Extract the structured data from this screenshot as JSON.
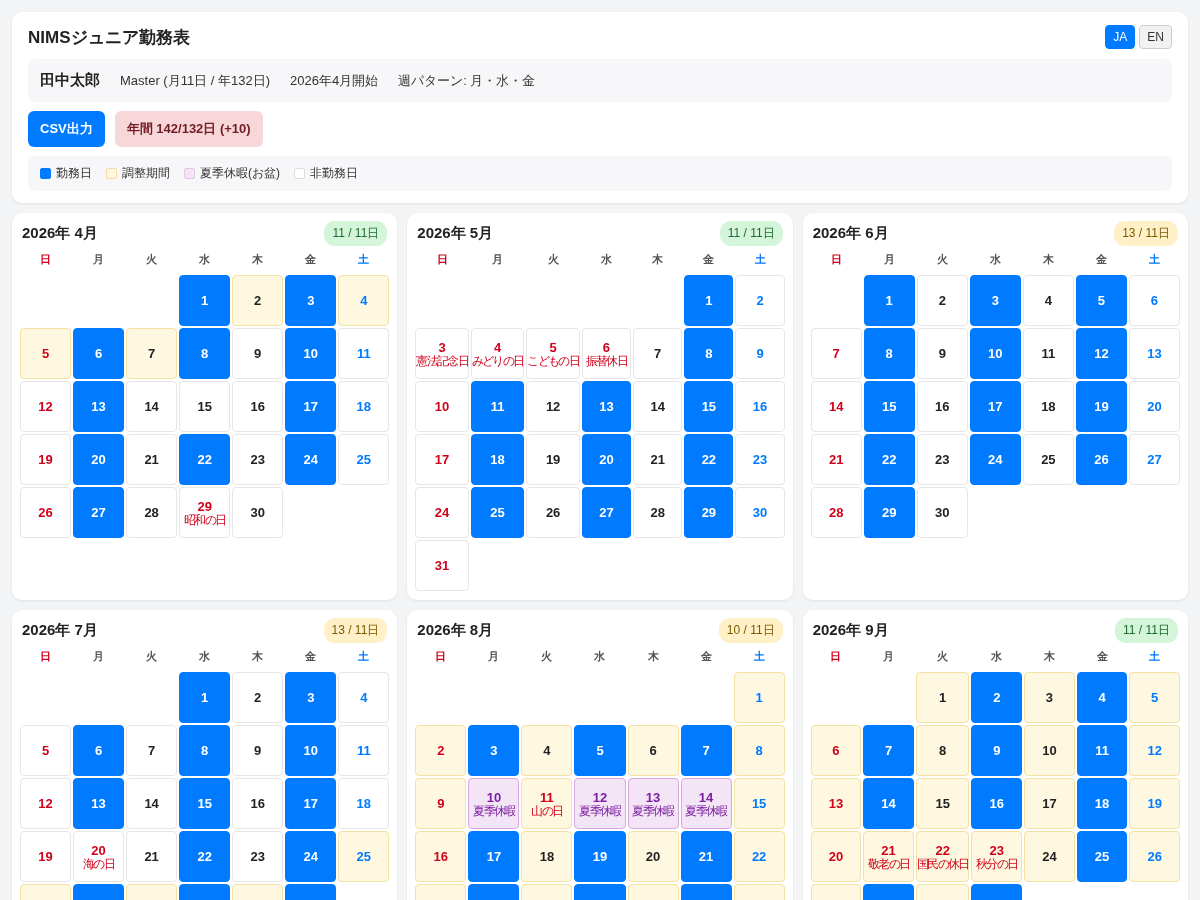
{
  "header": {
    "title": "NIMSジュニア勤務表",
    "languages": [
      {
        "label": "JA",
        "selected": true
      },
      {
        "label": "EN",
        "selected": false
      }
    ],
    "info": {
      "name": "田中太郎",
      "items": [
        "Master (月11日 / 年132日)",
        "2026年4月開始",
        "週パターン: 月・水・金"
      ]
    },
    "export_button": "CSV出力",
    "annual_badge": "年間 142/132日 (+10)",
    "legend": [
      {
        "label": "勤務日",
        "kind": "work"
      },
      {
        "label": "調整期間",
        "kind": "adjust"
      },
      {
        "label": "夏季休暇(お盆)",
        "kind": "summer"
      },
      {
        "label": "非勤務日",
        "kind": "off"
      }
    ]
  },
  "months": [
    {
      "title": "2026年 4月",
      "badge": {
        "text": "11 / 11日",
        "kind": "met"
      },
      "weekdays": [
        "日",
        "月",
        "火",
        "水",
        "木",
        "金",
        "土"
      ],
      "days": [
        {
          "kind": "blank"
        },
        {
          "kind": "blank"
        },
        {
          "kind": "blank"
        },
        {
          "day": "1",
          "kind": "work"
        },
        {
          "day": "2",
          "kind": "adjust"
        },
        {
          "day": "3",
          "kind": "work"
        },
        {
          "day": "4",
          "kind": "adjust"
        },
        {
          "day": "5",
          "kind": "adjust"
        },
        {
          "day": "6",
          "kind": "work"
        },
        {
          "day": "7",
          "kind": "adjust"
        },
        {
          "day": "8",
          "kind": "work"
        },
        {
          "day": "9",
          "kind": "off"
        },
        {
          "day": "10",
          "kind": "work"
        },
        {
          "day": "11",
          "kind": "off"
        },
        {
          "day": "12",
          "kind": "off"
        },
        {
          "day": "13",
          "kind": "work"
        },
        {
          "day": "14",
          "kind": "off"
        },
        {
          "day": "15",
          "kind": "off"
        },
        {
          "day": "16",
          "kind": "off"
        },
        {
          "day": "17",
          "kind": "work"
        },
        {
          "day": "18",
          "kind": "off"
        },
        {
          "day": "19",
          "kind": "off"
        },
        {
          "day": "20",
          "kind": "work"
        },
        {
          "day": "21",
          "kind": "off"
        },
        {
          "day": "22",
          "kind": "work"
        },
        {
          "day": "23",
          "kind": "off"
        },
        {
          "day": "24",
          "kind": "work"
        },
        {
          "day": "25",
          "kind": "off"
        },
        {
          "day": "26",
          "kind": "off"
        },
        {
          "day": "27",
          "kind": "work"
        },
        {
          "day": "28",
          "kind": "off"
        },
        {
          "day": "29",
          "kind": "off",
          "holiday": "昭和の日"
        },
        {
          "day": "30",
          "kind": "off"
        }
      ]
    },
    {
      "title": "2026年 5月",
      "badge": {
        "text": "11 / 11日",
        "kind": "met"
      },
      "weekdays": [
        "日",
        "月",
        "火",
        "水",
        "木",
        "金",
        "土"
      ],
      "days": [
        {
          "kind": "blank"
        },
        {
          "kind": "blank"
        },
        {
          "kind": "blank"
        },
        {
          "kind": "blank"
        },
        {
          "kind": "blank"
        },
        {
          "day": "1",
          "kind": "work"
        },
        {
          "day": "2",
          "kind": "off"
        },
        {
          "day": "3",
          "kind": "off",
          "holiday": "憲法記念日"
        },
        {
          "day": "4",
          "kind": "off",
          "holiday": "みどりの日"
        },
        {
          "day": "5",
          "kind": "off",
          "holiday": "こどもの日"
        },
        {
          "day": "6",
          "kind": "off",
          "holiday": "振替休日"
        },
        {
          "day": "7",
          "kind": "off"
        },
        {
          "day": "8",
          "kind": "work"
        },
        {
          "day": "9",
          "kind": "off"
        },
        {
          "day": "10",
          "kind": "off"
        },
        {
          "day": "11",
          "kind": "work"
        },
        {
          "day": "12",
          "kind": "off"
        },
        {
          "day": "13",
          "kind": "work"
        },
        {
          "day": "14",
          "kind": "off"
        },
        {
          "day": "15",
          "kind": "work"
        },
        {
          "day": "16",
          "kind": "off"
        },
        {
          "day": "17",
          "kind": "off"
        },
        {
          "day": "18",
          "kind": "work"
        },
        {
          "day": "19",
          "kind": "off"
        },
        {
          "day": "20",
          "kind": "work"
        },
        {
          "day": "21",
          "kind": "off"
        },
        {
          "day": "22",
          "kind": "work"
        },
        {
          "day": "23",
          "kind": "off"
        },
        {
          "day": "24",
          "kind": "off"
        },
        {
          "day": "25",
          "kind": "work"
        },
        {
          "day": "26",
          "kind": "off"
        },
        {
          "day": "27",
          "kind": "work"
        },
        {
          "day": "28",
          "kind": "off"
        },
        {
          "day": "29",
          "kind": "work"
        },
        {
          "day": "30",
          "kind": "off"
        },
        {
          "day": "31",
          "kind": "off"
        }
      ]
    },
    {
      "title": "2026年 6月",
      "badge": {
        "text": "13 / 11日",
        "kind": "over"
      },
      "weekdays": [
        "日",
        "月",
        "火",
        "水",
        "木",
        "金",
        "土"
      ],
      "days": [
        {
          "kind": "blank"
        },
        {
          "day": "1",
          "kind": "work"
        },
        {
          "day": "2",
          "kind": "off"
        },
        {
          "day": "3",
          "kind": "work"
        },
        {
          "day": "4",
          "kind": "off"
        },
        {
          "day": "5",
          "kind": "work"
        },
        {
          "day": "6",
          "kind": "off"
        },
        {
          "day": "7",
          "kind": "off"
        },
        {
          "day": "8",
          "kind": "work"
        },
        {
          "day": "9",
          "kind": "off"
        },
        {
          "day": "10",
          "kind": "work"
        },
        {
          "day": "11",
          "kind": "off"
        },
        {
          "day": "12",
          "kind": "work"
        },
        {
          "day": "13",
          "kind": "off"
        },
        {
          "day": "14",
          "kind": "off"
        },
        {
          "day": "15",
          "kind": "work"
        },
        {
          "day": "16",
          "kind": "off"
        },
        {
          "day": "17",
          "kind": "work"
        },
        {
          "day": "18",
          "kind": "off"
        },
        {
          "day": "19",
          "kind": "work"
        },
        {
          "day": "20",
          "kind": "off"
        },
        {
          "day": "21",
          "kind": "off"
        },
        {
          "day": "22",
          "kind": "work"
        },
        {
          "day": "23",
          "kind": "off"
        },
        {
          "day": "24",
          "kind": "work"
        },
        {
          "day": "25",
          "kind": "off"
        },
        {
          "day": "26",
          "kind": "work"
        },
        {
          "day": "27",
          "kind": "off"
        },
        {
          "day": "28",
          "kind": "off"
        },
        {
          "day": "29",
          "kind": "work"
        },
        {
          "day": "30",
          "kind": "off"
        }
      ]
    },
    {
      "title": "2026年 7月",
      "badge": {
        "text": "13 / 11日",
        "kind": "over"
      },
      "weekdays": [
        "日",
        "月",
        "火",
        "水",
        "木",
        "金",
        "土"
      ],
      "days": [
        {
          "kind": "blank"
        },
        {
          "kind": "blank"
        },
        {
          "kind": "blank"
        },
        {
          "day": "1",
          "kind": "work"
        },
        {
          "day": "2",
          "kind": "off"
        },
        {
          "day": "3",
          "kind": "work"
        },
        {
          "day": "4",
          "kind": "off"
        },
        {
          "day": "5",
          "kind": "off"
        },
        {
          "day": "6",
          "kind": "work"
        },
        {
          "day": "7",
          "kind": "off"
        },
        {
          "day": "8",
          "kind": "work"
        },
        {
          "day": "9",
          "kind": "off"
        },
        {
          "day": "10",
          "kind": "work"
        },
        {
          "day": "11",
          "kind": "off"
        },
        {
          "day": "12",
          "kind": "off"
        },
        {
          "day": "13",
          "kind": "work"
        },
        {
          "day": "14",
          "kind": "off"
        },
        {
          "day": "15",
          "kind": "work"
        },
        {
          "day": "16",
          "kind": "off"
        },
        {
          "day": "17",
          "kind": "work"
        },
        {
          "day": "18",
          "kind": "off"
        },
        {
          "day": "19",
          "kind": "off"
        },
        {
          "day": "20",
          "kind": "off",
          "holiday": "海の日"
        },
        {
          "day": "21",
          "kind": "off"
        },
        {
          "day": "22",
          "kind": "work"
        },
        {
          "day": "23",
          "kind": "off"
        },
        {
          "day": "24",
          "kind": "work"
        },
        {
          "day": "25",
          "kind": "adjust"
        },
        {
          "kind": "adjust"
        },
        {
          "kind": "work"
        },
        {
          "kind": "adjust"
        },
        {
          "kind": "work"
        },
        {
          "kind": "adjust"
        },
        {
          "kind": "work"
        }
      ]
    },
    {
      "title": "2026年 8月",
      "badge": {
        "text": "10 / 11日",
        "kind": "over"
      },
      "weekdays": [
        "日",
        "月",
        "火",
        "水",
        "木",
        "金",
        "土"
      ],
      "days": [
        {
          "kind": "blank"
        },
        {
          "kind": "blank"
        },
        {
          "kind": "blank"
        },
        {
          "kind": "blank"
        },
        {
          "kind": "blank"
        },
        {
          "kind": "blank"
        },
        {
          "day": "1",
          "kind": "adjust"
        },
        {
          "day": "2",
          "kind": "adjust"
        },
        {
          "day": "3",
          "kind": "work"
        },
        {
          "day": "4",
          "kind": "adjust"
        },
        {
          "day": "5",
          "kind": "work"
        },
        {
          "day": "6",
          "kind": "adjust"
        },
        {
          "day": "7",
          "kind": "work"
        },
        {
          "day": "8",
          "kind": "adjust"
        },
        {
          "day": "9",
          "kind": "adjust"
        },
        {
          "day": "10",
          "kind": "summer",
          "holiday": "夏季休暇"
        },
        {
          "day": "11",
          "kind": "adjust",
          "holiday": "山の日"
        },
        {
          "day": "12",
          "kind": "summer",
          "holiday": "夏季休暇"
        },
        {
          "day": "13",
          "kind": "summer",
          "holiday": "夏季休暇"
        },
        {
          "day": "14",
          "kind": "summer",
          "holiday": "夏季休暇"
        },
        {
          "day": "15",
          "kind": "adjust"
        },
        {
          "day": "16",
          "kind": "adjust"
        },
        {
          "day": "17",
          "kind": "work"
        },
        {
          "day": "18",
          "kind": "adjust"
        },
        {
          "day": "19",
          "kind": "work"
        },
        {
          "day": "20",
          "kind": "adjust"
        },
        {
          "day": "21",
          "kind": "work"
        },
        {
          "day": "22",
          "kind": "adjust"
        },
        {
          "kind": "adjust"
        },
        {
          "kind": "work"
        },
        {
          "kind": "adjust"
        },
        {
          "kind": "work"
        },
        {
          "kind": "adjust"
        },
        {
          "kind": "work"
        },
        {
          "kind": "adjust"
        }
      ]
    },
    {
      "title": "2026年 9月",
      "badge": {
        "text": "11 / 11日",
        "kind": "met"
      },
      "weekdays": [
        "日",
        "月",
        "火",
        "水",
        "木",
        "金",
        "土"
      ],
      "days": [
        {
          "kind": "blank"
        },
        {
          "kind": "blank"
        },
        {
          "day": "1",
          "kind": "adjust"
        },
        {
          "day": "2",
          "kind": "work"
        },
        {
          "day": "3",
          "kind": "adjust"
        },
        {
          "day": "4",
          "kind": "work"
        },
        {
          "day": "5",
          "kind": "adjust"
        },
        {
          "day": "6",
          "kind": "adjust"
        },
        {
          "day": "7",
          "kind": "work"
        },
        {
          "day": "8",
          "kind": "adjust"
        },
        {
          "day": "9",
          "kind": "work"
        },
        {
          "day": "10",
          "kind": "adjust"
        },
        {
          "day": "11",
          "kind": "work"
        },
        {
          "day": "12",
          "kind": "adjust"
        },
        {
          "day": "13",
          "kind": "adjust"
        },
        {
          "day": "14",
          "kind": "work"
        },
        {
          "day": "15",
          "kind": "adjust"
        },
        {
          "day": "16",
          "kind": "work"
        },
        {
          "day": "17",
          "kind": "adjust"
        },
        {
          "day": "18",
          "kind": "work"
        },
        {
          "day": "19",
          "kind": "adjust"
        },
        {
          "day": "20",
          "kind": "adjust"
        },
        {
          "day": "21",
          "kind": "adjust",
          "holiday": "敬老の日"
        },
        {
          "day": "22",
          "kind": "adjust",
          "holiday": "国民の休日"
        },
        {
          "day": "23",
          "kind": "adjust",
          "holiday": "秋分の日"
        },
        {
          "day": "24",
          "kind": "adjust"
        },
        {
          "day": "25",
          "kind": "work"
        },
        {
          "day": "26",
          "kind": "adjust"
        },
        {
          "kind": "adjust"
        },
        {
          "kind": "work"
        },
        {
          "kind": "adjust"
        },
        {
          "kind": "work"
        }
      ]
    }
  ]
}
